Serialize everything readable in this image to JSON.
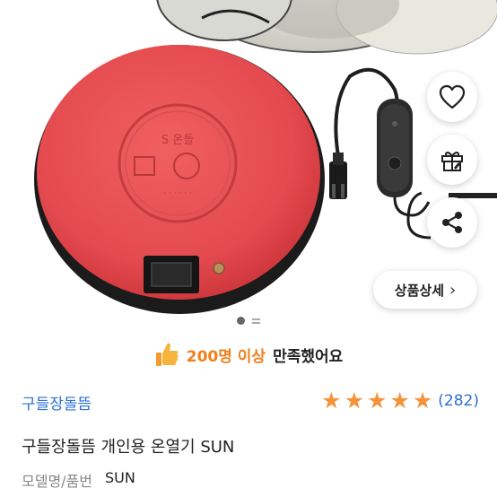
{
  "actions": {
    "detail_label": "상품상세",
    "detail_chevron": "›"
  },
  "icons": {
    "wishlist": "heart-icon",
    "gift": "gift-icon",
    "share": "share-icon"
  },
  "carousel": {
    "current": 1,
    "total": 2
  },
  "satisfaction": {
    "count_text": "200명 이상",
    "rest_text": "만족했어요"
  },
  "product": {
    "category": "구들장돌뜸",
    "rating_stars": 5,
    "review_count": "(282)",
    "title": "구들장돌뜸 개인용 온열기 SUN",
    "model_label": "모델명/품번",
    "model_value": "SUN"
  },
  "colors": {
    "accent_blue": "#2b6fd6",
    "accent_orange": "#f07f1a",
    "star": "#f5933a",
    "product_red": "#e8494f"
  }
}
